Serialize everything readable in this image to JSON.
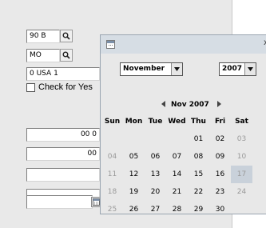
{
  "form": {
    "field1_value": "90 B",
    "field2_value": "MO",
    "field3_value": "0 USA 1",
    "checkbox_label": "Check for Yes",
    "amount1_value": "00 0",
    "amount2_value": "00",
    "amount3_value": "",
    "amount4_value": "",
    "date_value": ""
  },
  "calendar": {
    "close_label": "x",
    "month_selected": "November",
    "year_selected": "2007",
    "nav_title": "Nov 2007",
    "day_headers": [
      "Sun",
      "Mon",
      "Tue",
      "Wed",
      "Thu",
      "Fri",
      "Sat"
    ],
    "weeks": [
      [
        "",
        "",
        "",
        "",
        "01",
        "02",
        "03"
      ],
      [
        "04",
        "05",
        "06",
        "07",
        "08",
        "09",
        "10"
      ],
      [
        "11",
        "12",
        "13",
        "14",
        "15",
        "16",
        "17"
      ],
      [
        "18",
        "19",
        "20",
        "21",
        "22",
        "23",
        "24"
      ],
      [
        "25",
        "26",
        "27",
        "28",
        "29",
        "30",
        ""
      ]
    ],
    "highlighted_day": "17"
  },
  "colors": {
    "panel_background": "#e9e9e9",
    "popup_titlebar": "#d6dde4",
    "highlight": "#c9d1da",
    "weekend_text": "#9a9a9a"
  },
  "icons": {
    "lookup": "magnifier-icon",
    "calendar": "calendar-icon",
    "dropdown": "chevron-down-icon",
    "prev": "triangle-left-icon",
    "next": "triangle-right-icon"
  }
}
